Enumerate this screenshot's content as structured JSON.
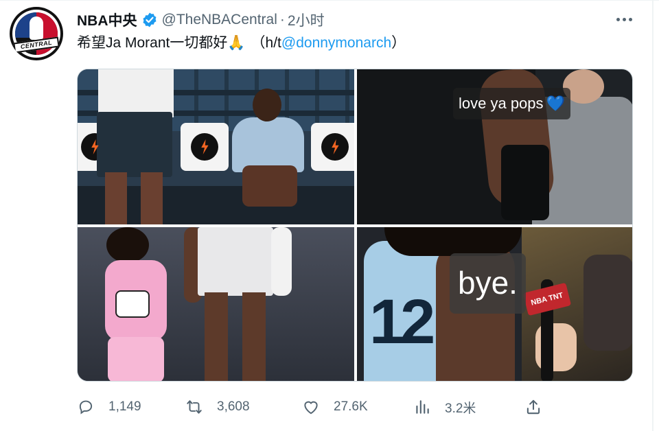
{
  "tweet": {
    "display_name": "NBA中央",
    "handle": "@TheNBACentral",
    "separator": "·",
    "time": "2小时",
    "text_main": "希望Ja Morant一切都好",
    "emoji": "🙏",
    "text_paren_open": "（h/t",
    "mention": "@donnymonarch",
    "text_paren_close": "）"
  },
  "avatar": {
    "banner_text": "CENTRAL"
  },
  "media": {
    "caption_top_right": "love ya pops",
    "caption_top_right_emoji": "💙",
    "caption_bottom_right": "bye.",
    "jersey_number": "12",
    "mic_flag_text": "NBA TNT"
  },
  "actions": {
    "replies": "1,149",
    "retweets": "3,608",
    "likes": "27.6K",
    "views": "3.2米"
  },
  "icons": {
    "verified": "verified-badge-icon",
    "more": "more-options-icon",
    "reply": "reply-icon",
    "retweet": "retweet-icon",
    "like": "heart-icon",
    "views": "views-bar-icon",
    "share": "share-icon"
  },
  "colors": {
    "text": "#0f1419",
    "secondary": "#536471",
    "link": "#1d9bf0",
    "verified": "#1d9bf0"
  }
}
